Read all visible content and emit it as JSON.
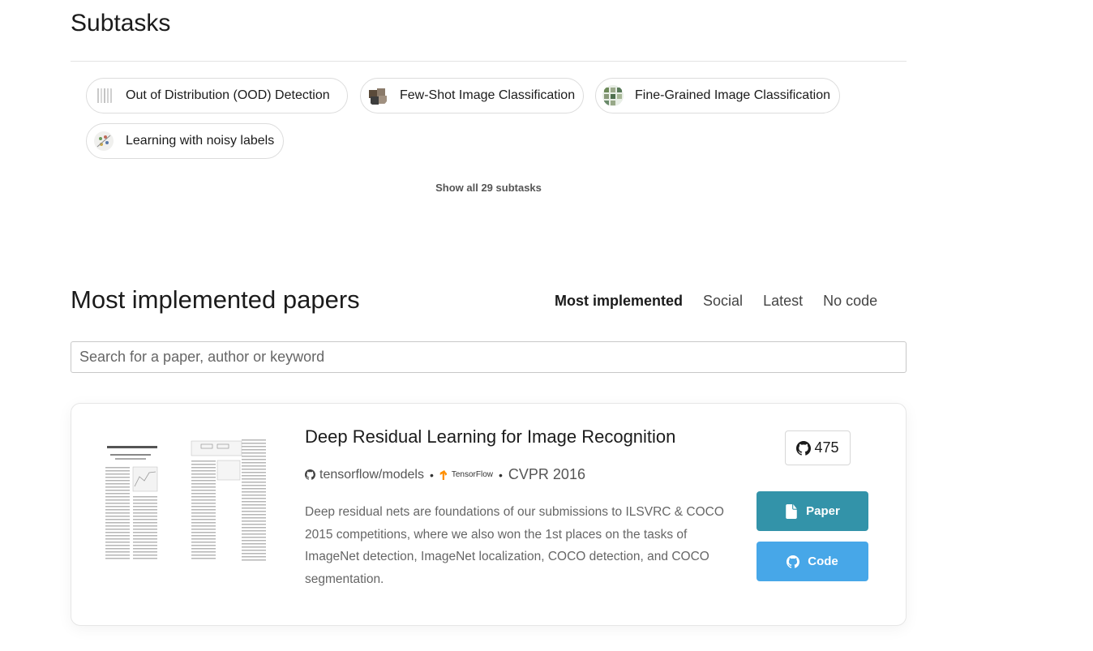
{
  "subtasks": {
    "title": "Subtasks",
    "items": [
      {
        "label": "Out of Distribution (OOD) Detection"
      },
      {
        "label": "Few-Shot Image Classification"
      },
      {
        "label": "Fine-Grained Image Classification"
      },
      {
        "label": "Learning with noisy labels"
      }
    ],
    "show_all": "Show all 29 subtasks"
  },
  "papers": {
    "title": "Most implemented papers",
    "tabs": [
      {
        "label": "Most implemented",
        "active": true
      },
      {
        "label": "Social",
        "active": false
      },
      {
        "label": "Latest",
        "active": false
      },
      {
        "label": "No code",
        "active": false
      }
    ],
    "search_placeholder": "Search for a paper, author or keyword",
    "items": [
      {
        "title": "Deep Residual Learning for Image Recognition",
        "repo": "tensorflow/models",
        "framework": "TensorFlow",
        "conference": "CVPR 2016",
        "abstract": "Deep residual nets are foundations of our submissions to ILSVRC & COCO 2015 competitions, where we also won the 1st places on the tasks of ImageNet detection, ImageNet localization, COCO detection, and COCO segmentation.",
        "stars": "475",
        "paper_button": "Paper",
        "code_button": "Code"
      }
    ]
  },
  "colors": {
    "paper_button": "#3393a9",
    "code_button": "#47a7e8",
    "tensorflow": "#ff8f00"
  }
}
